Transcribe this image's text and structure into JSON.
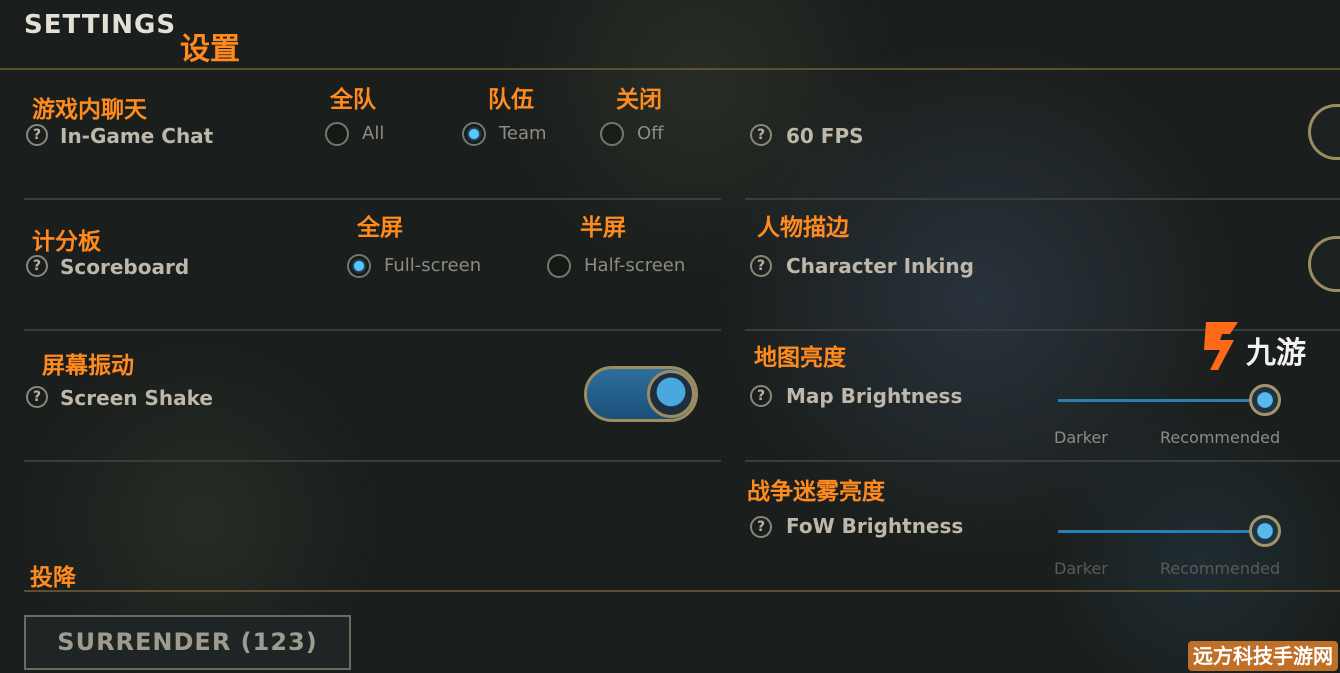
{
  "header": {
    "title": "SETTINGS",
    "title_cn": "设置"
  },
  "chat": {
    "label_cn": "游戏内聊天",
    "label": "In-Game Chat",
    "help": "?",
    "options": [
      {
        "cn": "全队",
        "label": "All",
        "selected": false
      },
      {
        "cn": "队伍",
        "label": "Team",
        "selected": true
      },
      {
        "cn": "关闭",
        "label": "Off",
        "selected": false
      }
    ]
  },
  "fps": {
    "label": "60 FPS",
    "help": "?"
  },
  "scoreboard": {
    "label_cn": "计分板",
    "label": "Scoreboard",
    "help": "?",
    "options": [
      {
        "cn": "全屏",
        "label": "Full-screen",
        "selected": true
      },
      {
        "cn": "半屏",
        "label": "Half-screen",
        "selected": false
      }
    ]
  },
  "inking": {
    "label_cn": "人物描边",
    "label": "Character Inking",
    "help": "?"
  },
  "shake": {
    "label_cn": "屏幕振动",
    "label": "Screen Shake",
    "help": "?",
    "enabled": true
  },
  "map_brightness": {
    "label_cn": "地图亮度",
    "label": "Map Brightness",
    "help": "?",
    "min_label": "Darker",
    "max_label": "Recommended",
    "value": 1.0
  },
  "fow_brightness": {
    "label_cn": "战争迷雾亮度",
    "label": "FoW Brightness",
    "help": "?",
    "min_label": "Darker",
    "max_label": "Recommended",
    "value": 1.0
  },
  "surrender": {
    "label_cn": "投降",
    "button": "SURRENDER (123)"
  },
  "watermark": {
    "logo_text": "九游",
    "site": "远方科技手游网"
  },
  "colors": {
    "accent_blue": "#56c7ff",
    "annotation_orange": "#ff8a1e",
    "gold": "#9c8d60"
  }
}
